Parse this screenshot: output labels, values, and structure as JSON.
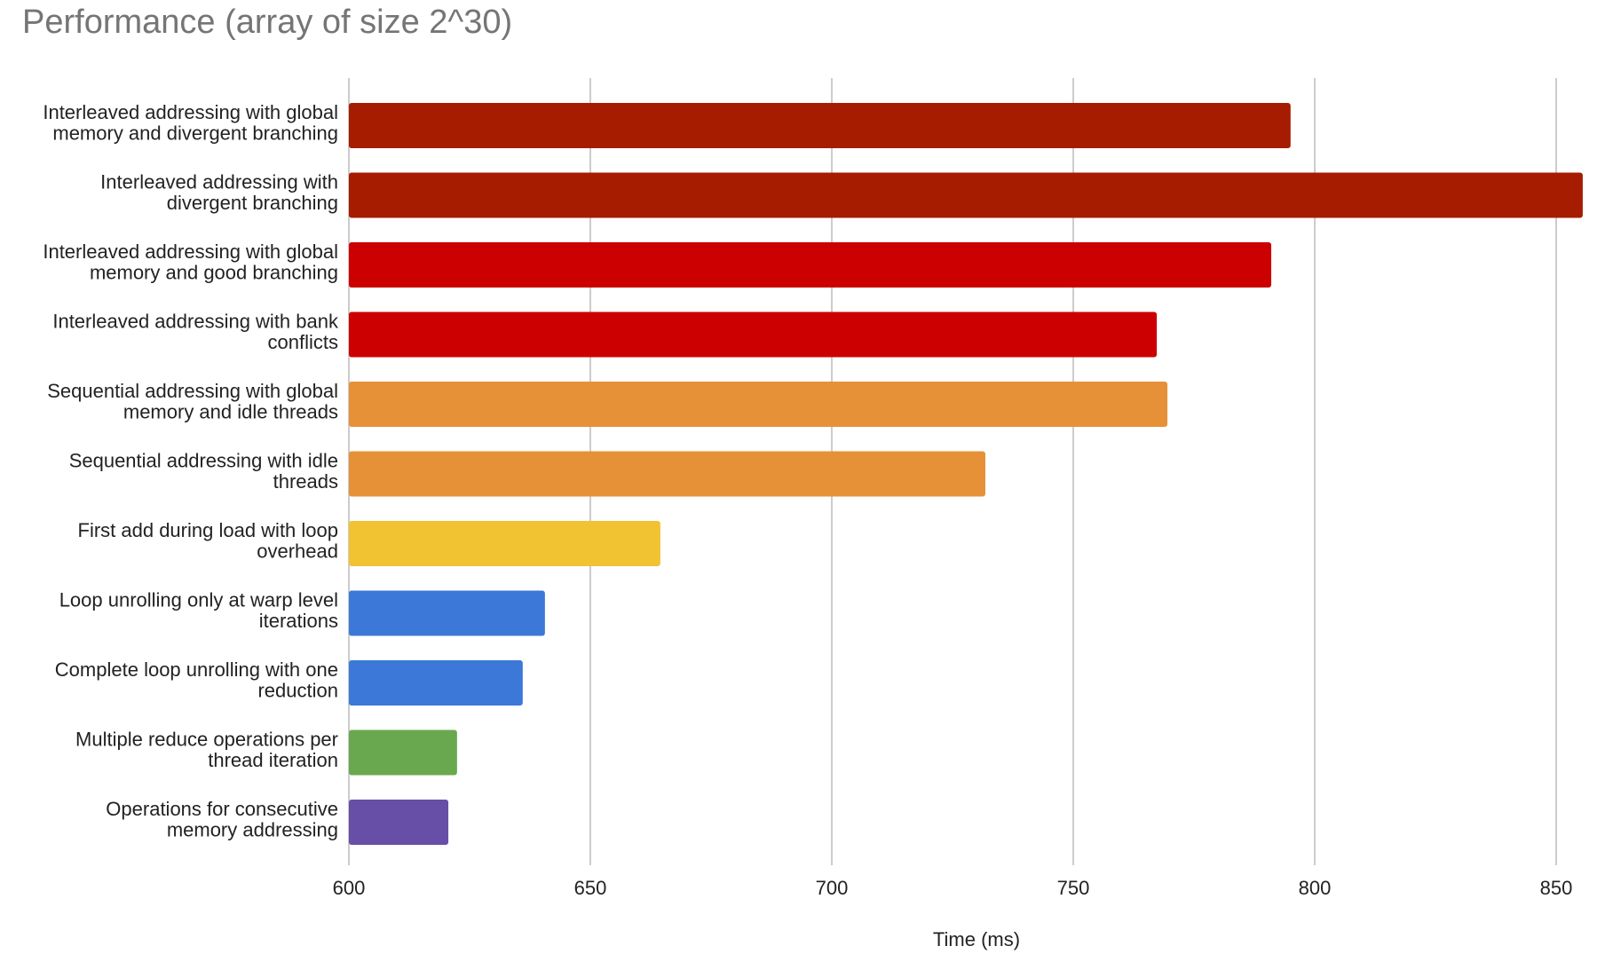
{
  "chart_data": {
    "type": "bar",
    "orientation": "horizontal",
    "title": "Performance (array of size 2^30)",
    "xlabel": "Time (ms)",
    "ylabel": "",
    "xlim": [
      600,
      857
    ],
    "xticks": [
      600,
      650,
      700,
      750,
      800,
      850
    ],
    "grid": true,
    "legend": "none",
    "categories": [
      [
        "Interleaved addressing with global",
        "memory and divergent branching"
      ],
      [
        "Interleaved addressing with",
        "divergent branching"
      ],
      [
        "Interleaved addressing with global",
        "memory and good branching"
      ],
      [
        "Interleaved addressing with bank",
        "conflicts"
      ],
      [
        "Sequential addressing with global",
        "memory and idle threads"
      ],
      [
        "Sequential addressing with idle",
        "threads"
      ],
      [
        "First add during load with loop",
        "overhead"
      ],
      [
        "Loop unrolling only at warp level",
        "iterations"
      ],
      [
        "Complete loop unrolling with one",
        "reduction"
      ],
      [
        "Multiple reduce operations per",
        "thread iteration"
      ],
      [
        "Operations for consecutive",
        "memory addressing"
      ]
    ],
    "values": [
      795,
      855.5,
      791,
      767.3,
      769.5,
      731.8,
      664.5,
      640.6,
      636,
      622.4,
      620.6
    ],
    "colors": [
      "#a61c00",
      "#a61c00",
      "#cc0000",
      "#cc0000",
      "#e69138",
      "#e69138",
      "#f1c232",
      "#3c78d8",
      "#3c78d8",
      "#6aa84f",
      "#674ea7"
    ]
  }
}
